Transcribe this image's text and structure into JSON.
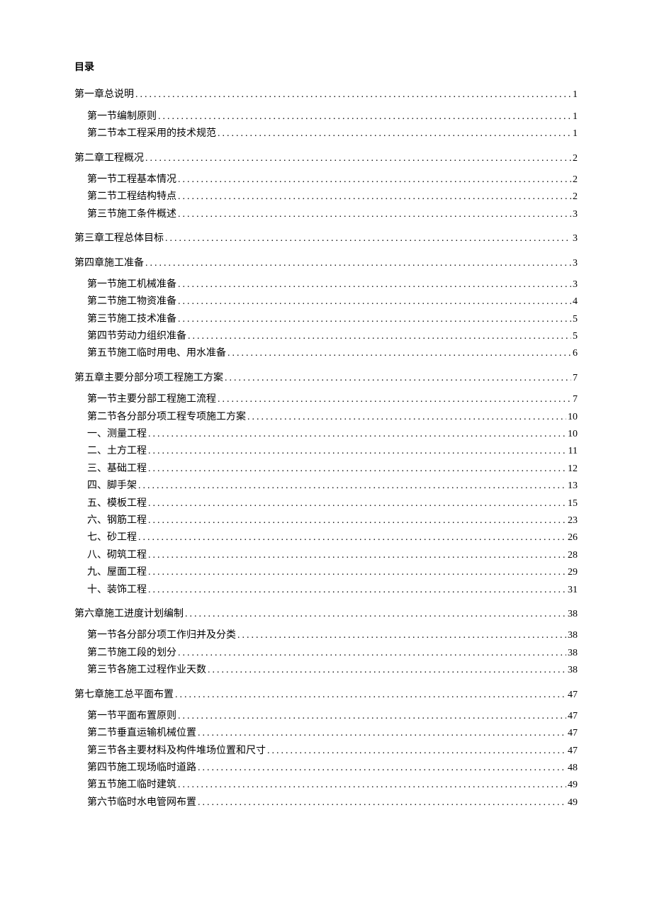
{
  "title": "目录",
  "toc": [
    {
      "level": 1,
      "label": "第一章总说明",
      "page": "1"
    },
    {
      "level": 2,
      "label": "第一节编制原则",
      "page": "1"
    },
    {
      "level": 2,
      "label": "第二节本工程采用的技术规范",
      "page": "1"
    },
    {
      "level": 1,
      "label": "第二章工程概况",
      "page": "2"
    },
    {
      "level": 2,
      "label": "第一节工程基本情况",
      "page": "2"
    },
    {
      "level": 2,
      "label": "第二节工程结构特点",
      "page": "2"
    },
    {
      "level": 2,
      "label": "第三节施工条件概述",
      "page": "3"
    },
    {
      "level": 1,
      "label": "第三章工程总体目标",
      "page": "3"
    },
    {
      "level": 1,
      "label": "第四章施工准备",
      "page": "3"
    },
    {
      "level": 2,
      "label": "第一节施工机械准备",
      "page": "3"
    },
    {
      "level": 2,
      "label": "第二节施工物资准备",
      "page": "4"
    },
    {
      "level": 2,
      "label": "第三节施工技术准备",
      "page": "5"
    },
    {
      "level": 2,
      "label": "第四节劳动力组织准备",
      "page": "5"
    },
    {
      "level": 2,
      "label": "第五节施工临时用电、用水准备",
      "page": "6"
    },
    {
      "level": 1,
      "label": "第五章主要分部分项工程施工方案",
      "page": "7"
    },
    {
      "level": 2,
      "label": "第一节主要分部工程施工流程",
      "page": "7"
    },
    {
      "level": 2,
      "label": "第二节各分部分项工程专项施工方案",
      "page": "10"
    },
    {
      "level": 3,
      "label": "一、测量工程",
      "page": "10"
    },
    {
      "level": 3,
      "label": "二、土方工程",
      "page": "11"
    },
    {
      "level": 3,
      "label": "三、基础工程",
      "page": "12"
    },
    {
      "level": 3,
      "label": "四、脚手架",
      "page": "13"
    },
    {
      "level": 3,
      "label": "五、模板工程",
      "page": "15"
    },
    {
      "level": 3,
      "label": "六、钢筋工程",
      "page": "23"
    },
    {
      "level": 3,
      "label": "七、砂工程",
      "page": "26"
    },
    {
      "level": 3,
      "label": "八、砌筑工程",
      "page": "28"
    },
    {
      "level": 3,
      "label": "九、屋面工程",
      "page": "29"
    },
    {
      "level": 3,
      "label": "十、装饰工程",
      "page": "31"
    },
    {
      "level": 1,
      "label": "第六章施工进度计划编制",
      "page": "38"
    },
    {
      "level": 2,
      "label": "第一节各分部分项工作归并及分类",
      "page": "38"
    },
    {
      "level": 2,
      "label": "第二节施工段的划分",
      "page": "38"
    },
    {
      "level": 2,
      "label": "第三节各施工过程作业天数",
      "page": "38"
    },
    {
      "level": 1,
      "label": "第七章施工总平面布置",
      "page": "47"
    },
    {
      "level": 2,
      "label": "第一节平面布置原则",
      "page": "47"
    },
    {
      "level": 2,
      "label": "第二节垂直运输机械位置",
      "page": "47"
    },
    {
      "level": 2,
      "label": "第三节各主要材料及构件堆场位置和尺寸",
      "page": "47"
    },
    {
      "level": 2,
      "label": "第四节施工现场临时道路",
      "page": "48"
    },
    {
      "level": 2,
      "label": "第五节施工临时建筑",
      "page": "49"
    },
    {
      "level": 2,
      "label": "第六节临时水电管网布置",
      "page": "49"
    }
  ]
}
